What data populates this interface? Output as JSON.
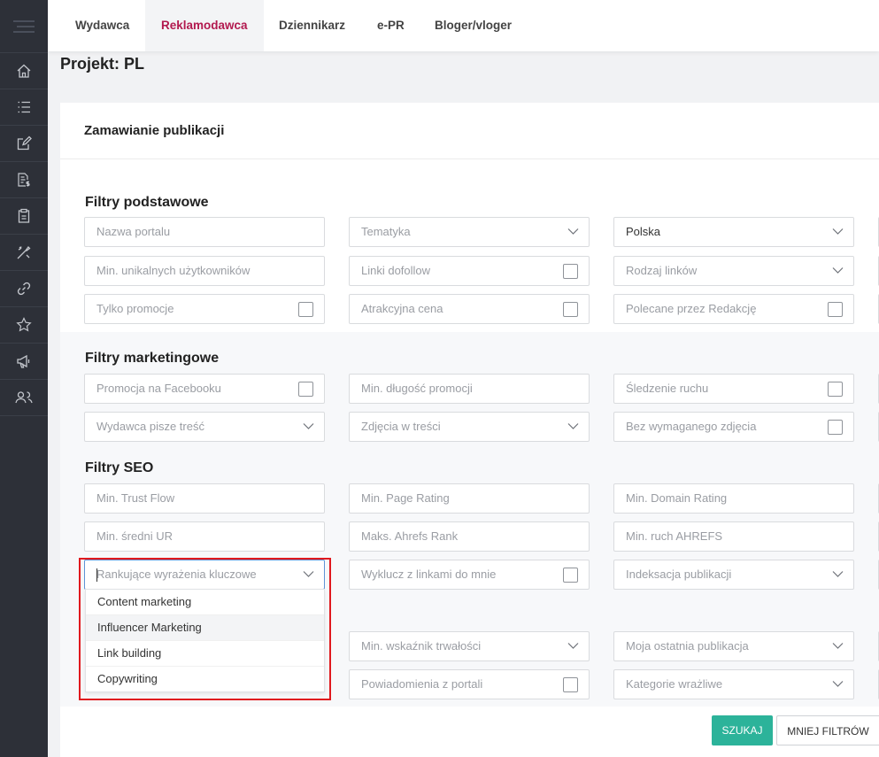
{
  "topnav": {
    "tabs": [
      {
        "label": "Wydawca"
      },
      {
        "label": "Reklamodawca"
      },
      {
        "label": "Dziennikarz"
      },
      {
        "label": "e-PR"
      },
      {
        "label": "Bloger/vloger"
      }
    ],
    "active_tab": "Reklamodawca"
  },
  "page": {
    "title": "Projekt: PL",
    "card_title": "Zamawianie publikacji"
  },
  "sections": {
    "basic": {
      "title": "Filtry podstawowe",
      "fields": [
        {
          "placeholder": "Nazwa portalu"
        },
        {
          "placeholder": "Tematyka"
        },
        {
          "value": "Polska"
        },
        {
          "placeholder": "Min. unikalnych użytkowników"
        },
        {
          "placeholder": "Linki dofollow"
        },
        {
          "placeholder": "Rodzaj linków"
        },
        {
          "placeholder": "Tylko promocje"
        },
        {
          "placeholder": "Atrakcyjna cena"
        },
        {
          "placeholder": "Polecane przez Redakcję"
        }
      ]
    },
    "marketing": {
      "title": "Filtry marketingowe",
      "fields": [
        {
          "placeholder": "Promocja na Facebooku"
        },
        {
          "placeholder": "Min. długość promocji"
        },
        {
          "placeholder": "Śledzenie ruchu"
        },
        {
          "placeholder": "Wydawca pisze treść"
        },
        {
          "placeholder": "Zdjęcia w treści"
        },
        {
          "placeholder": "Bez wymaganego zdjęcia"
        }
      ]
    },
    "seo": {
      "title": "Filtry SEO",
      "fields": [
        {
          "placeholder": "Min. Trust Flow"
        },
        {
          "placeholder": "Min. Page Rating"
        },
        {
          "placeholder": "Min. Domain Rating"
        },
        {
          "placeholder": "Min. średni UR"
        },
        {
          "placeholder": "Maks. Ahrefs Rank"
        },
        {
          "placeholder": "Min. ruch AHREFS"
        },
        {
          "placeholder": "Rankujące wyrażenia kluczowe"
        },
        {
          "placeholder": "Wyklucz z linkami do mnie"
        },
        {
          "placeholder": "Indeksacja publikacji"
        },
        {
          "placeholder": "Min. wskaźnik trwałości"
        },
        {
          "placeholder": "Moja ostatnia publikacja"
        },
        {
          "placeholder": "Powiadomienia z portali"
        },
        {
          "placeholder": "Kategorie wrażliwe"
        }
      ]
    }
  },
  "keyword_dropdown": {
    "options": [
      {
        "label": "Content marketing"
      },
      {
        "label": "Influencer Marketing"
      },
      {
        "label": "Link building"
      },
      {
        "label": "Copywriting"
      }
    ],
    "hovered": "Influencer Marketing"
  },
  "buttons": {
    "search": "SZUKAJ",
    "less_filters": "MNIEJ FILTRÓW"
  },
  "colors": {
    "sidebar": "#2d3038",
    "active_tab": "#b2194f",
    "search_button": "#2cb39a",
    "highlight": "#e0191e"
  },
  "icons": {
    "sidebar": [
      "menu-icon",
      "home-icon",
      "list-icon",
      "edit-icon",
      "invoice-icon",
      "clipboard-icon",
      "tools-icon",
      "link-icon",
      "star-icon",
      "megaphone-icon",
      "users-icon"
    ]
  }
}
